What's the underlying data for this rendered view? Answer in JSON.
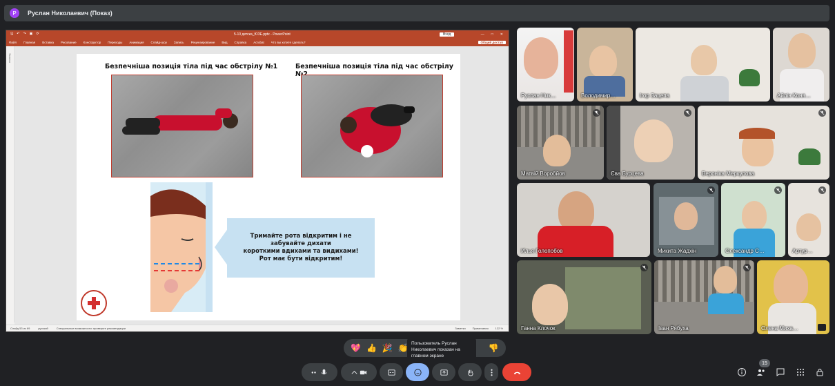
{
  "topbar": {
    "avatar_letter": "Р",
    "title": "Руслан Николаевич (Показ)"
  },
  "ppt": {
    "quick_access": [
      "🖫",
      "↶",
      "↷",
      "▣",
      "⟳"
    ],
    "filename": "5-10 детска_ЮЗЕ.pptx - PowerPoint",
    "signin": "Вход",
    "window_buttons": [
      "—",
      "□",
      "✕"
    ],
    "menu": [
      "Файл",
      "Главная",
      "Вставка",
      "Рисование",
      "Конструктор",
      "Переходы",
      "Анимация",
      "Слайд-шоу",
      "Запись",
      "Рецензирование",
      "Вид",
      "Справка",
      "Acrobat",
      "Что вы хотите сделать?"
    ],
    "share": "Общий доступ",
    "left_label": "Эскизы",
    "slide": {
      "heading1": "Безпечніша позиція тіла під час обстрілу №1",
      "heading2": "Безпечніша позиція тіла під час обстрілу №2",
      "callout_lines": [
        "Тримайте рота відкритим і  не",
        "забувайте дихати",
        "короткими вдихами та видихами!",
        "Рот має бути відкритим!"
      ]
    },
    "status": {
      "slide": "Слайд 53 из 69",
      "lang": "русский",
      "accessibility": "Специальные возможности: проверьте рекомендации",
      "notes": "Заметки",
      "comments": "Примечания",
      "zoom": "122 %"
    }
  },
  "participants": [
    {
      "name": "Руслан Ник…",
      "mic": false
    },
    {
      "name": "Володимир…",
      "mic": false
    },
    {
      "name": "Ігор Зацепа",
      "mic": false
    },
    {
      "name": "Айлін Коня…",
      "mic": false
    },
    {
      "name": "Матвій Воробйов",
      "mic": true
    },
    {
      "name": "Єва Бурцева",
      "mic": true
    },
    {
      "name": "Вероніка Меркулова",
      "mic": true
    },
    {
      "name": "Илья Голопобов",
      "mic": false
    },
    {
      "name": "Микита Жадхін",
      "mic": true
    },
    {
      "name": "Олександр С…",
      "mic": true
    },
    {
      "name": "Артур…",
      "mic": true
    },
    {
      "name": "Ганна Клочок",
      "mic": true
    },
    {
      "name": "Іван Рябуха",
      "mic": true
    },
    {
      "name": "Олена Миха…",
      "mic": false
    }
  ],
  "reactions": [
    "💖",
    "👍",
    "🎉",
    "👏",
    "😂",
    "😮",
    "😢",
    "🤔",
    "👎"
  ],
  "toast": "Пользователь Руслан Николаевич показан на главном экране",
  "participant_count": "15",
  "colors": {
    "ppt_red": "#b7472a",
    "end_call": "#ea4335",
    "active_btn": "#8ab4f8"
  }
}
